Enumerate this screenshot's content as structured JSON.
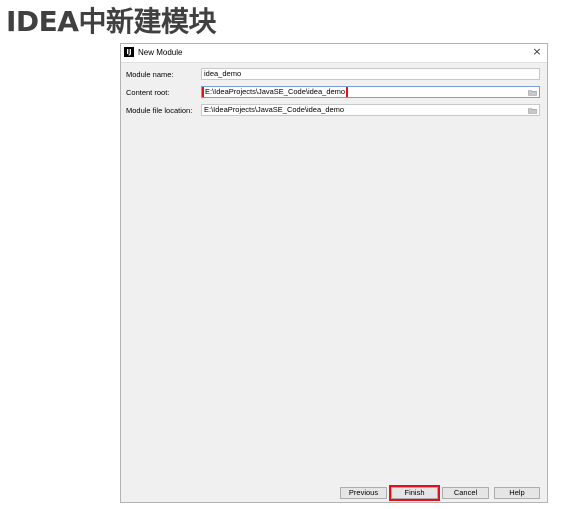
{
  "slide": {
    "title": "IDEA中新建模块"
  },
  "window": {
    "title": "New Module",
    "app_icon": "intellij-idea-icon",
    "close_glyph": "×"
  },
  "form": {
    "module_name_label": "Module name:",
    "module_name_value": "idea_demo",
    "content_root_label": "Content root:",
    "content_root_value": "E:\\IdeaProjects\\JavaSE_Code\\idea_demo",
    "module_file_location_label": "Module file location:",
    "module_file_location_value": "E:\\IdeaProjects\\JavaSE_Code\\idea_demo"
  },
  "buttons": {
    "previous": "Previous",
    "finish": "Finish",
    "cancel": "Cancel",
    "help": "Help"
  },
  "icons": {
    "folder": "folder-icon",
    "close": "close-icon"
  },
  "colors": {
    "highlight": "#e3101a",
    "dialog_bg": "#f0f0f0"
  }
}
